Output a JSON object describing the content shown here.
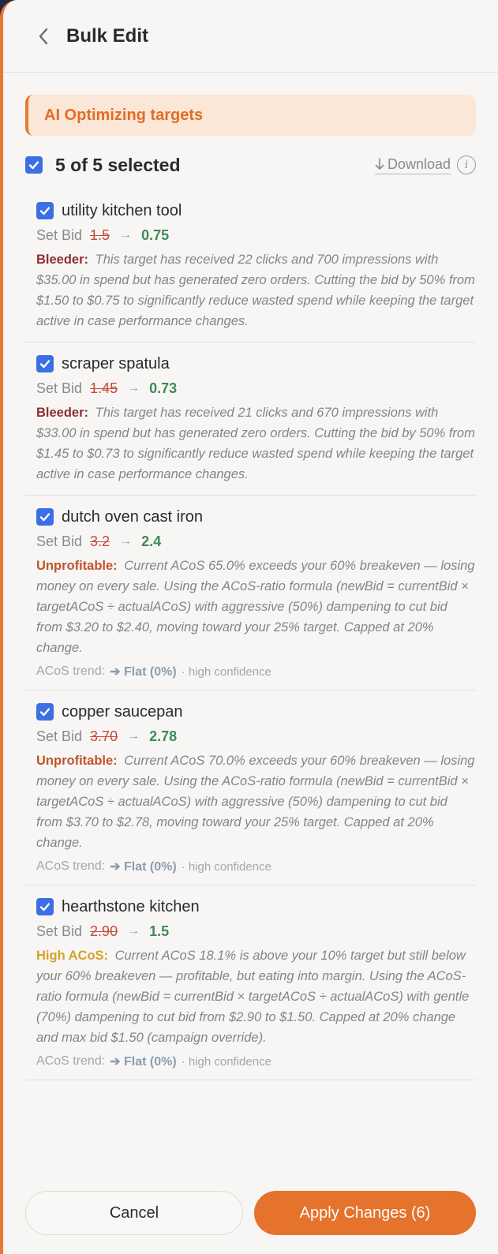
{
  "header": {
    "title": "Bulk Edit",
    "back_icon": "chevron-left-icon"
  },
  "banner": {
    "text": "AI Optimizing targets"
  },
  "selection": {
    "count_text": "5 of 5 selected",
    "download_label": "Download",
    "info_label": "i"
  },
  "bid_label": "Set Bid",
  "items": [
    {
      "name": "utility kitchen tool",
      "old_bid": "1.5",
      "new_bid": "0.75",
      "tag": "Bleeder:",
      "desc": "This target has received 22 clicks and 700 impressions with $35.00 in spend but has generated zero orders. Cutting the bid by 50% from $1.50 to $0.75 to significantly reduce wasted spend while keeping the target active in case performance changes."
    },
    {
      "name": "scraper spatula",
      "old_bid": "1.45",
      "new_bid": "0.73",
      "tag": "Bleeder:",
      "desc": "This target has received 21 clicks and 670 impressions with $33.00 in spend but has generated zero orders. Cutting the bid by 50% from $1.45 to $0.73 to significantly reduce wasted spend while keeping the target active in case performance changes."
    },
    {
      "name": "dutch oven cast iron",
      "old_bid": "3.2",
      "new_bid": "2.4",
      "tag": "Unprofitable:",
      "desc": "Current ACoS 65.0% exceeds your 60% breakeven — losing money on every sale. Using the ACoS-ratio formula (newBid = currentBid × targetACoS ÷ actualACoS) with aggressive (50%) dampening to cut bid from $3.20 to $2.40, moving toward your 25% target. Capped at 20% change.",
      "trend_label": "ACoS trend:",
      "trend_value": "➔ Flat (0%)",
      "trend_conf": "· high confidence"
    },
    {
      "name": "copper saucepan",
      "old_bid": "3.70",
      "new_bid": "2.78",
      "tag": "Unprofitable:",
      "desc": "Current ACoS 70.0% exceeds your 60% breakeven — losing money on every sale. Using the ACoS-ratio formula (newBid = currentBid × targetACoS ÷ actualACoS) with aggressive (50%) dampening to cut bid from $3.70 to $2.78, moving toward your 25% target. Capped at 20% change.",
      "trend_label": "ACoS trend:",
      "trend_value": "➔ Flat (0%)",
      "trend_conf": "· high confidence"
    },
    {
      "name": "hearthstone kitchen",
      "old_bid": "2.90",
      "new_bid": "1.5",
      "tag": "High ACoS:",
      "desc": "Current ACoS 18.1% is above your 10% target but still below your 60% breakeven — profitable, but eating into margin. Using the ACoS-ratio formula (newBid = currentBid × targetACoS ÷ actualACoS) with gentle (70%) dampening to cut bid from $2.90 to $1.50. Capped at 20% change and max bid $1.50 (campaign override).",
      "trend_label": "ACoS trend:",
      "trend_value": "➔ Flat (0%)",
      "trend_conf": "· high confidence"
    }
  ],
  "footer": {
    "cancel_label": "Cancel",
    "apply_label": "Apply Changes (6)"
  },
  "colors": {
    "accent": "#e5732c",
    "checkbox": "#3c6fe4",
    "bleeder": "#8e2f34",
    "unprofitable": "#c0552b",
    "high_acos": "#d4a12a",
    "new_bid": "#3f8a58",
    "old_bid": "#c44a3a"
  }
}
